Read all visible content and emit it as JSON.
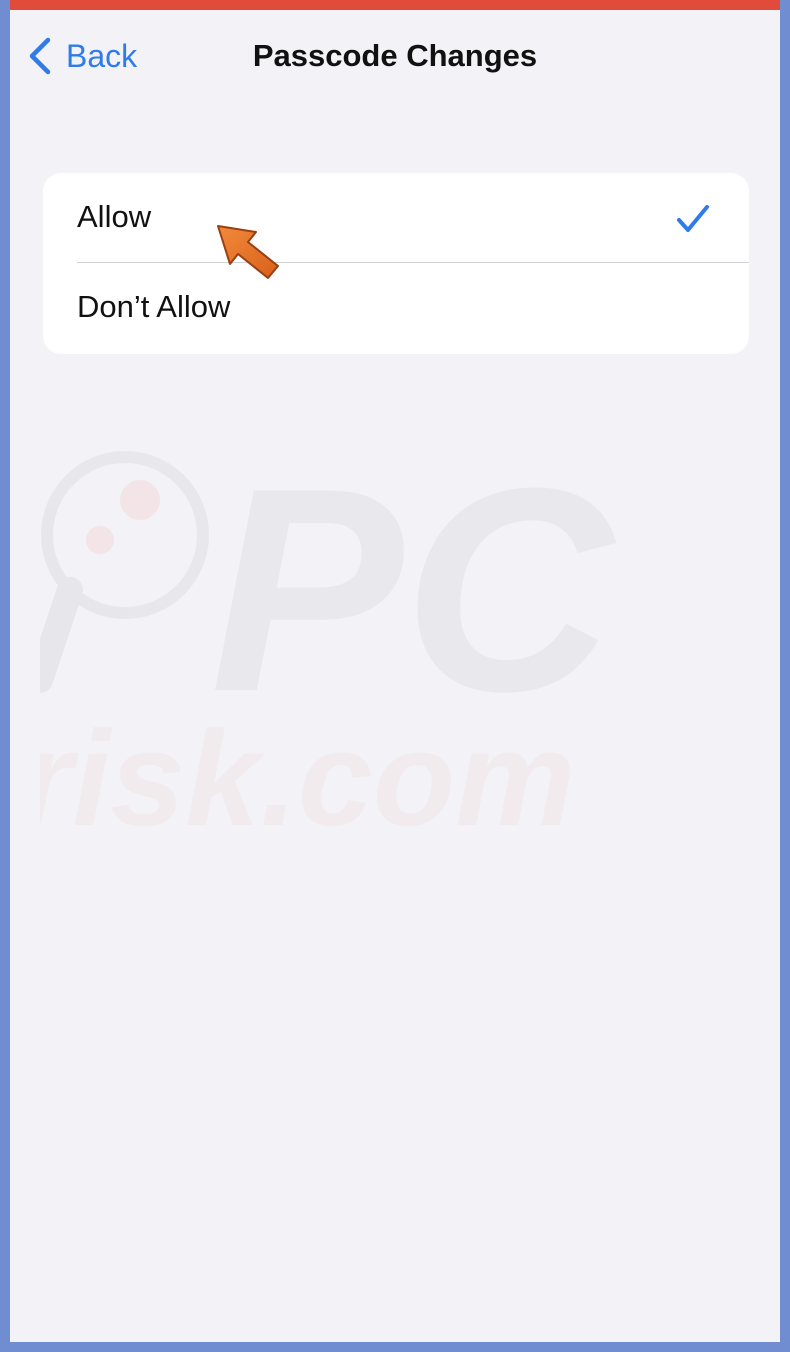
{
  "nav": {
    "back_label": "Back",
    "title": "Passcode Changes"
  },
  "options": [
    {
      "label": "Allow",
      "selected": true
    },
    {
      "label": "Don’t Allow",
      "selected": false
    }
  ],
  "watermark": {
    "line1": "PC",
    "line2": "risk.com"
  },
  "colors": {
    "accent": "#2f7bea",
    "pointer": "#e8742d",
    "background": "#f2f2f7",
    "frame": "#6f8dd0",
    "status_strip": "#e04b3b"
  },
  "icons": {
    "back": "chevron-left-icon",
    "selected": "checkmark-icon",
    "annotation": "arrow-pointer-icon"
  }
}
